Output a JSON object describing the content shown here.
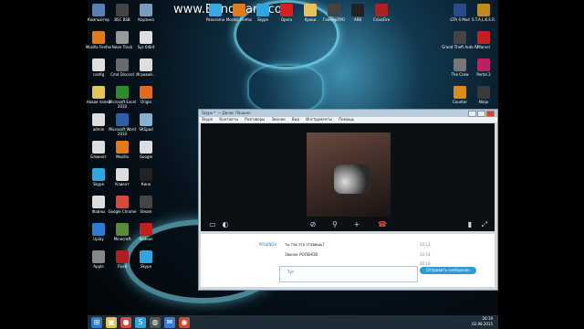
{
  "watermark": "www.Bandicam.com",
  "desktop_icons_left": [
    {
      "label": "Компьютер",
      "color": "#5a7fb0"
    },
    {
      "label": "BSC BSB",
      "color": "#444"
    },
    {
      "label": "Корзина",
      "color": "#7a9cc0"
    },
    {
      "label": "Mozilla Firefox",
      "color": "#e27a1c"
    },
    {
      "label": "Neon Track",
      "color": "#999"
    },
    {
      "label": "Sys 64bit",
      "color": "#ddd"
    },
    {
      "label": "config",
      "color": "#ddd"
    },
    {
      "label": "Cmd Discord",
      "color": "#6a6a6a"
    },
    {
      "label": "Игровой…",
      "color": "#ddd"
    },
    {
      "label": "Новая папка",
      "color": "#e2c45a"
    },
    {
      "label": "Microsoft Excel 2010",
      "color": "#2e8b2e"
    },
    {
      "label": "Origin",
      "color": "#e06a20"
    },
    {
      "label": "admin",
      "color": "#ddd"
    },
    {
      "label": "Microsoft Word 2010",
      "color": "#2d5ea8"
    },
    {
      "label": "SKSpad",
      "color": "#8ab0d0"
    },
    {
      "label": "Блокнот",
      "color": "#ddd"
    },
    {
      "label": "Mozilla",
      "color": "#e27a1c"
    },
    {
      "label": "Google",
      "color": "#ddd"
    },
    {
      "label": "Skype",
      "color": "#2fa6e0"
    },
    {
      "label": "Клиент",
      "color": "#ddd"
    },
    {
      "label": "Кино",
      "color": "#222"
    },
    {
      "label": "Файлы",
      "color": "#ddd"
    },
    {
      "label": "Google Chrome",
      "color": "#d84b3a"
    },
    {
      "label": "Steam",
      "color": "#444"
    },
    {
      "label": "Uplay",
      "color": "#2e7bd4"
    },
    {
      "label": "Minecraft",
      "color": "#5b8a3a"
    },
    {
      "label": "Radeon",
      "color": "#c02020"
    },
    {
      "label": "Apple",
      "color": "#888"
    },
    {
      "label": "Flash",
      "color": "#b02020"
    },
    {
      "label": "Skype",
      "color": "#2fa6e0"
    }
  ],
  "desktop_icons_top": [
    {
      "label": "Panorama",
      "color": "#3aa7e6"
    },
    {
      "label": "Mozilla Firefox",
      "color": "#e27a1c"
    },
    {
      "label": "Skype",
      "color": "#2fa6e0"
    },
    {
      "label": "Opera",
      "color": "#d42020"
    },
    {
      "label": "Кряки",
      "color": "#e2c45a"
    },
    {
      "label": "ГеймерПРО",
      "color": "#444"
    },
    {
      "label": "ARB",
      "color": "#222"
    },
    {
      "label": "CrossFire",
      "color": "#b02020"
    }
  ],
  "desktop_icons_right": [
    {
      "label": "GTA 4 Mod",
      "color": "#2a4a8a"
    },
    {
      "label": "S.T.A.L.K.E.R.",
      "color": "#c08a20"
    },
    {
      "label": "Grand Theft Auto IV",
      "color": "#444"
    },
    {
      "label": "Marvel",
      "color": "#c02020"
    },
    {
      "label": "The Crew",
      "color": "#777"
    },
    {
      "label": "Portal 2",
      "color": "#c02060"
    },
    {
      "label": "Counter",
      "color": "#d88a20"
    },
    {
      "label": "Ninja",
      "color": "#3a3a3a"
    }
  ],
  "skype_window": {
    "title": "Skype™ — Денис Лёшкин",
    "menus": [
      "Skype",
      "Контакты",
      "Разговоры",
      "Звонки",
      "Вид",
      "Инструменты",
      "Помощь"
    ],
    "messages": [
      {
        "sender": "POLENOV",
        "text": "ты так это ставишь?",
        "time": "20:12"
      },
      {
        "sender": "",
        "text": "Звонок РОЛЕНОВ",
        "time": "20:14"
      },
      {
        "sender": "",
        "text": "Звонок",
        "time": "20:18"
      }
    ],
    "input_placeholder": "Тут",
    "send_label": "Отправить сообщение"
  },
  "taskbar": {
    "items": [
      {
        "name": "start",
        "glyph": "⊞",
        "color": "#2b7bd1"
      },
      {
        "name": "explorer",
        "glyph": "▣",
        "color": "#e2c45a"
      },
      {
        "name": "chrome",
        "glyph": "●",
        "color": "#d84b3a"
      },
      {
        "name": "skype",
        "glyph": "S",
        "color": "#2fa6e0"
      },
      {
        "name": "steam",
        "glyph": "◍",
        "color": "#555"
      },
      {
        "name": "mail",
        "glyph": "✉",
        "color": "#3a7bd5"
      },
      {
        "name": "bandicam",
        "glyph": "◉",
        "color": "#c84b2f"
      }
    ],
    "time": "20:19",
    "date": "02.08.2015"
  }
}
